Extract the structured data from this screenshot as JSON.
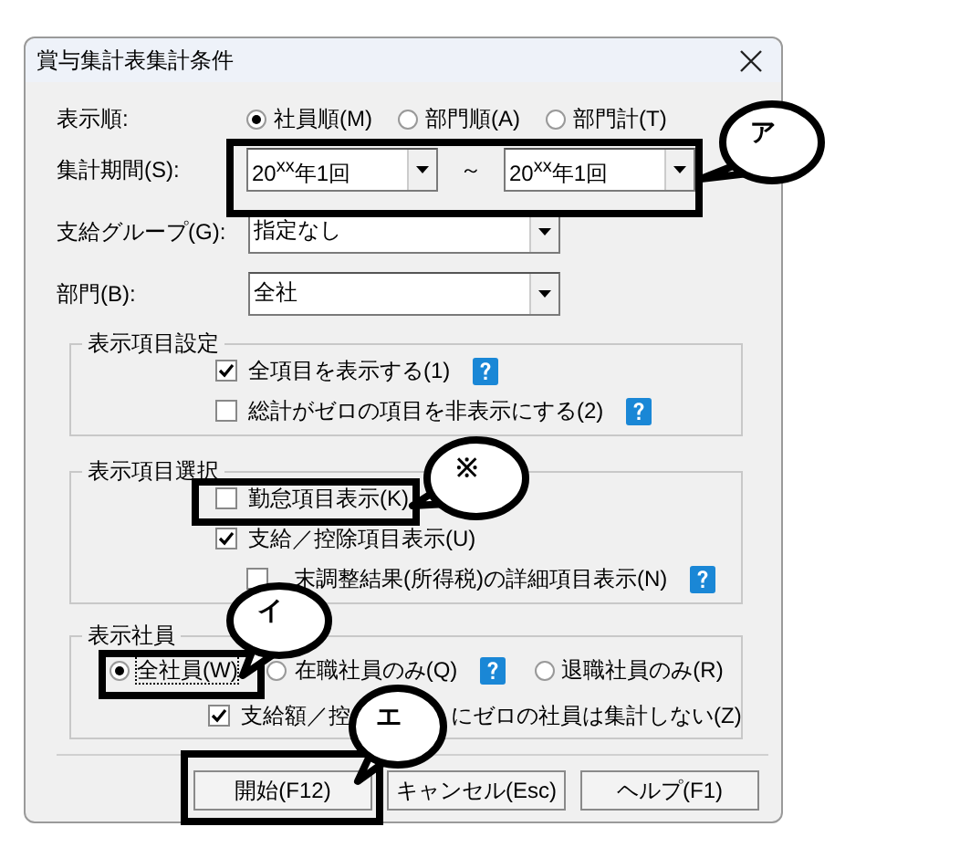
{
  "dialog": {
    "title": "賞与集計表集計条件"
  },
  "display_order": {
    "label": "表示順:",
    "options": [
      {
        "label": "社員順(M)",
        "selected": true
      },
      {
        "label": "部門順(A)",
        "selected": false
      },
      {
        "label": "部門計(T)",
        "selected": false
      }
    ]
  },
  "period": {
    "label": "集計期間(S):",
    "from": "20$^{xx}$年1回",
    "separator": "～",
    "to": "20$^{xx}$年1回"
  },
  "pay_group": {
    "label": "支給グループ(G):",
    "value": "指定なし"
  },
  "department": {
    "label": "部門(B):",
    "value": "全社"
  },
  "groups": [
    {
      "title": "表示項目設定",
      "rows": [
        {
          "kind": "checkbox",
          "texts": [
            "全項目を表示する(1)"
          ],
          "checked": true,
          "help": true
        },
        {
          "kind": "checkbox",
          "texts": [
            "総計がゼロの項目を非表示にする(2)"
          ],
          "checked": false,
          "help": true
        }
      ]
    },
    {
      "title": "表示項目選択",
      "rows": [
        {
          "kind": "checkbox",
          "texts": [
            "勤怠項目表示(K)"
          ],
          "checked": false
        },
        {
          "kind": "checkbox",
          "texts": [
            "支給／控除項目表示(U)"
          ],
          "checked": true,
          "children": [
            {
              "kind": "checkbox",
              "texts": [
                "末調整結果(所得税)の詳細項目表示(N)"
              ],
              "checked": false,
              "help": true
            }
          ]
        }
      ]
    },
    {
      "title": "表示社員",
      "rows": [
        {
          "kind": "radios",
          "options": [
            {
              "label": "全社員(W)",
              "selected": true
            },
            {
              "label": "在職社員のみ(Q)",
              "selected": false,
              "help": true
            },
            {
              "label": "退職社員のみ(R)",
              "selected": false
            }
          ]
        },
        {
          "kind": "checkbox",
          "texts": [
            "支給額／控",
            "にゼロの社員は集計しない(Z)"
          ],
          "checked": true
        }
      ]
    }
  ],
  "buttons": [
    {
      "label": "開始(F12)"
    },
    {
      "label": "キャンセル(Esc)"
    },
    {
      "label": "ヘルプ(F1)"
    }
  ],
  "callouts": [
    {
      "label": "ア"
    },
    {
      "label": "※"
    },
    {
      "label": "イ"
    },
    {
      "label": "エ"
    }
  ]
}
